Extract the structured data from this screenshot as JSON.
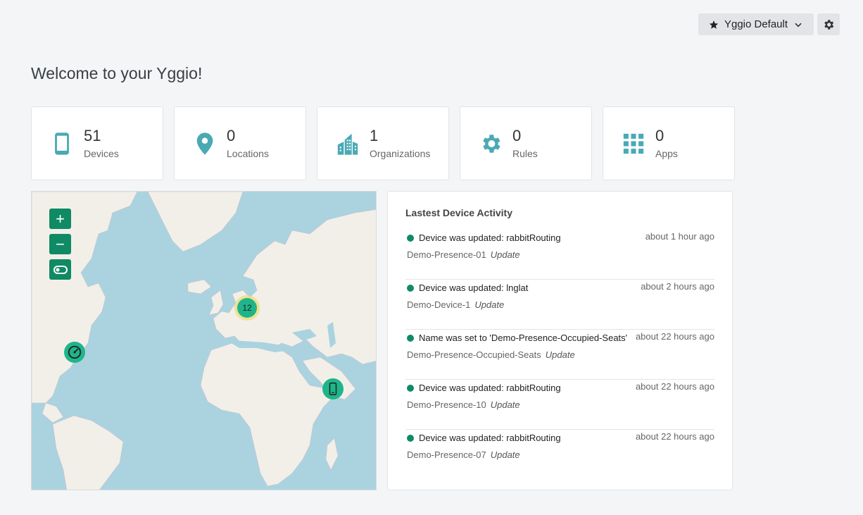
{
  "header": {
    "workspace_label": "Yggio Default",
    "star_icon": "star-icon",
    "chevron_icon": "chevron-down-icon",
    "settings_icon": "gear-icon"
  },
  "welcome": "Welcome to your Yggio!",
  "stats": [
    {
      "count": "51",
      "label": "Devices",
      "icon": "phone-icon"
    },
    {
      "count": "0",
      "label": "Locations",
      "icon": "map-pin-icon"
    },
    {
      "count": "1",
      "label": "Organizations",
      "icon": "buildings-icon"
    },
    {
      "count": "0",
      "label": "Rules",
      "icon": "gear-icon"
    },
    {
      "count": "0",
      "label": "Apps",
      "icon": "grid-icon"
    }
  ],
  "map": {
    "controls": {
      "zoom_in": "+",
      "zoom_out": "−"
    },
    "cluster_count": "12"
  },
  "activity": {
    "title": "Lastest Device Activity",
    "items": [
      {
        "message": "Device was updated: rabbitRouting",
        "time": "about 1 hour ago",
        "device": "Demo-Presence-01",
        "action": "Update"
      },
      {
        "message": "Device was updated: lnglat",
        "time": "about 2 hours ago",
        "device": "Demo-Device-1",
        "action": "Update"
      },
      {
        "message": "Name was set to 'Demo-Presence-Occupied-Seats'",
        "time": "about 22 hours ago",
        "device": "Demo-Presence-Occupied-Seats",
        "action": "Update"
      },
      {
        "message": "Device was updated: rabbitRouting",
        "time": "about 22 hours ago",
        "device": "Demo-Presence-10",
        "action": "Update"
      },
      {
        "message": "Device was updated: rabbitRouting",
        "time": "about 22 hours ago",
        "device": "Demo-Presence-07",
        "action": "Update"
      }
    ]
  },
  "colors": {
    "accent": "#0f8a65",
    "icon_teal": "#4aa9b5",
    "marker": "#1fb58a"
  }
}
